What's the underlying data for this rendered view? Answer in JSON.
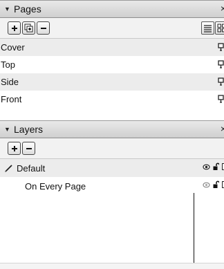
{
  "pages_panel": {
    "title": "Pages",
    "close_glyph": "×",
    "toolbar": {
      "add_icon": "plus-icon",
      "duplicate_icon": "duplicate-page-icon",
      "remove_icon": "minus-icon",
      "list_view_icon": "list-view-icon",
      "thumbnail_view_icon": "thumbnail-view-icon"
    },
    "pages": [
      {
        "label": "Cover"
      },
      {
        "label": "Top"
      },
      {
        "label": "Side"
      },
      {
        "label": "Front"
      }
    ]
  },
  "layers_panel": {
    "title": "Layers",
    "close_glyph": "×",
    "toolbar": {
      "add_icon": "plus-icon",
      "remove_icon": "minus-icon"
    },
    "layers": [
      {
        "label": "Default",
        "selected": true,
        "visibility": "visible",
        "lock": "unlocked"
      },
      {
        "label": "On Every Page",
        "selected": false,
        "visibility": "hidden",
        "lock": "unlocked"
      }
    ]
  }
}
